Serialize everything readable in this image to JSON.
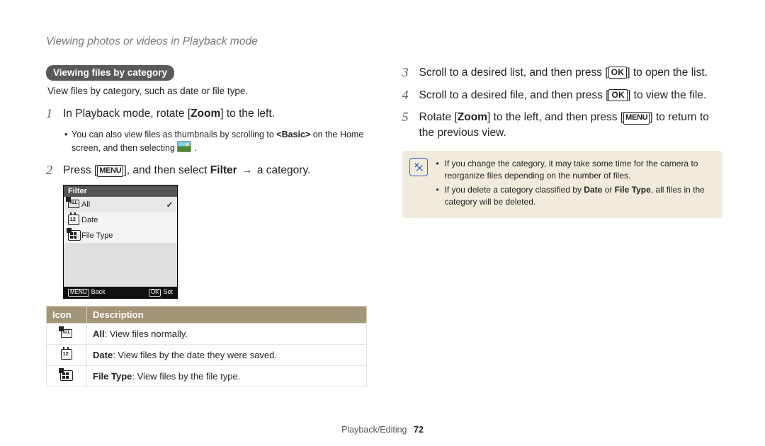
{
  "header": "Viewing photos or videos in Playback mode",
  "section_title": "Viewing files by category",
  "section_caption": "View files by category, such as date or file type.",
  "steps": {
    "s1": {
      "num": "1",
      "pre": "In Playback mode, rotate [",
      "key": "Zoom",
      "post": "] to the left."
    },
    "s1_sub_a": "You can also view files as thumbnails by scrolling to ",
    "s1_sub_basic": "<Basic>",
    "s1_sub_b": " on the Home screen, and then selecting ",
    "s2": {
      "num": "2",
      "pre": "Press [",
      "key": "MENU",
      "mid": "], and then select ",
      "bold": "Filter",
      "arrow": " → ",
      "post": "a category."
    },
    "s3": {
      "num": "3",
      "pre": "Scroll to a desired list, and then press [",
      "key": "OK",
      "post": "] to open the list."
    },
    "s4": {
      "num": "4",
      "pre": "Scroll to a desired file, and then press [",
      "key": "OK",
      "post": "] to view the file."
    },
    "s5": {
      "num": "5",
      "pre": "Rotate [",
      "key1": "Zoom",
      "mid": "] to the left, and then press [",
      "key2": "MENU",
      "post": "] to return to the previous view."
    }
  },
  "filter_panel": {
    "title": "Filter",
    "items": [
      "All",
      "Date",
      "File Type"
    ],
    "check": "✓",
    "back_key": "MENU",
    "back_label": "Back",
    "set_key": "OK",
    "set_label": "Set"
  },
  "icon_table": {
    "head_icon": "Icon",
    "head_desc": "Description",
    "rows": [
      {
        "name": "All",
        "desc": ": View files normally."
      },
      {
        "name": "Date",
        "desc": ": View files by the date they were saved."
      },
      {
        "name": "File Type",
        "desc": ": View files by the file type."
      }
    ]
  },
  "note": {
    "l1": "If you change the category, it may take some time for the camera to reorganize files depending on the number of files.",
    "l2a": "If you delete a category classified by ",
    "l2b1": "Date",
    "l2or": " or ",
    "l2b2": "File Type",
    "l2c": ", all files in the category will be deleted."
  },
  "footer": {
    "section": "Playback/Editing",
    "page": "72"
  }
}
